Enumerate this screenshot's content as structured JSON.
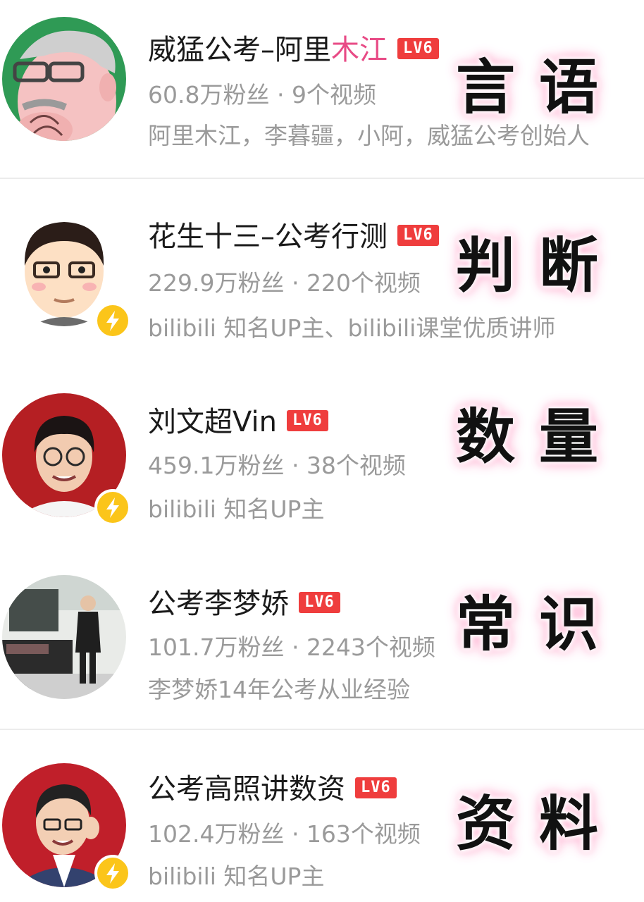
{
  "channels": [
    {
      "name_main": "威猛公考–阿里",
      "name_highlight": "木江",
      "level": "LV6",
      "stats": "60.8万粉丝 · 9个视频",
      "desc": "阿里木江，李暮疆，小阿，威猛公考创始人",
      "subject": "言语",
      "verified": false
    },
    {
      "name_main": "花生十三–公考行测",
      "name_highlight": "",
      "level": "LV6",
      "stats": "229.9万粉丝 · 220个视频",
      "desc": "bilibili 知名UP主、bilibili课堂优质讲师",
      "subject": "判断",
      "verified": true
    },
    {
      "name_main": "刘文超Vin",
      "name_highlight": "",
      "level": "LV6",
      "stats": "459.1万粉丝 · 38个视频",
      "desc": "bilibili 知名UP主",
      "subject": "数量",
      "verified": true
    },
    {
      "name_main": "公考李梦娇",
      "name_highlight": "",
      "level": "LV6",
      "stats": "101.7万粉丝 · 2243个视频",
      "desc": "李梦娇14年公考从业经验",
      "subject": "常识",
      "verified": false
    },
    {
      "name_main": "公考高照讲数资",
      "name_highlight": "",
      "level": "LV6",
      "stats": "102.4万粉丝 · 163个视频",
      "desc": "bilibili 知名UP主",
      "subject": "资料",
      "verified": true
    }
  ],
  "icons": {
    "verified_badge": "lightning-bolt-icon",
    "badge_color": "#fbc51a",
    "level_badge_color": "#ef3d3d",
    "highlight_color": "#e84b86"
  }
}
